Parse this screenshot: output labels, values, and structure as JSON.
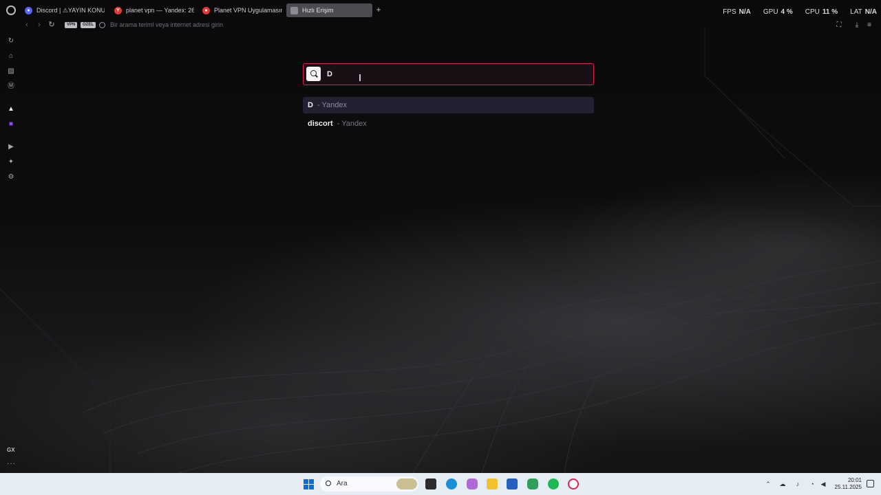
{
  "tabs": [
    {
      "label": "Discord | ⚠YAYIN KONU",
      "favicon": "discord-icon",
      "color": "#5865f2",
      "active": false
    },
    {
      "label": "planet vpn — Yandex: 26",
      "favicon": "yandex-icon",
      "color": "#e53935",
      "active": false
    },
    {
      "label": "Planet VPN Uygulamasını",
      "favicon": "planet-vpn-icon",
      "color": "#e53935",
      "active": false
    },
    {
      "label": "Hızlı Erişim",
      "favicon": "speed-dial-icon",
      "color": "#9a9aa2",
      "active": true
    }
  ],
  "hud": {
    "fps_label": "FPS",
    "fps_value": "N/A",
    "gpu_label": "GPU",
    "gpu_value": "4 %",
    "cpu_label": "CPU",
    "cpu_value": "11 %",
    "lat_label": "LAT",
    "lat_value": "N/A"
  },
  "address_bar": {
    "vpn_badge": "VPN",
    "private_badge": "ÖZEL",
    "placeholder": "Bir arama terimi veya internet adresi girin"
  },
  "sidebar": {
    "items": [
      "history-icon",
      "shop-icon",
      "sidebar-icon",
      "music-icon",
      "aria-icon",
      "twitch-icon",
      "player-icon",
      "extensions-icon",
      "settings-icon"
    ],
    "gx_label": "GX",
    "more_label": "···"
  },
  "search": {
    "value": "D",
    "suggestions": [
      {
        "term": "D",
        "source": "- Yandex"
      },
      {
        "term": "discort",
        "source": "- Yandex"
      }
    ]
  },
  "taskbar": {
    "search_label": "Ara",
    "time": "20:01",
    "date": "25.11.2025",
    "accent": "#0a6fd6"
  }
}
